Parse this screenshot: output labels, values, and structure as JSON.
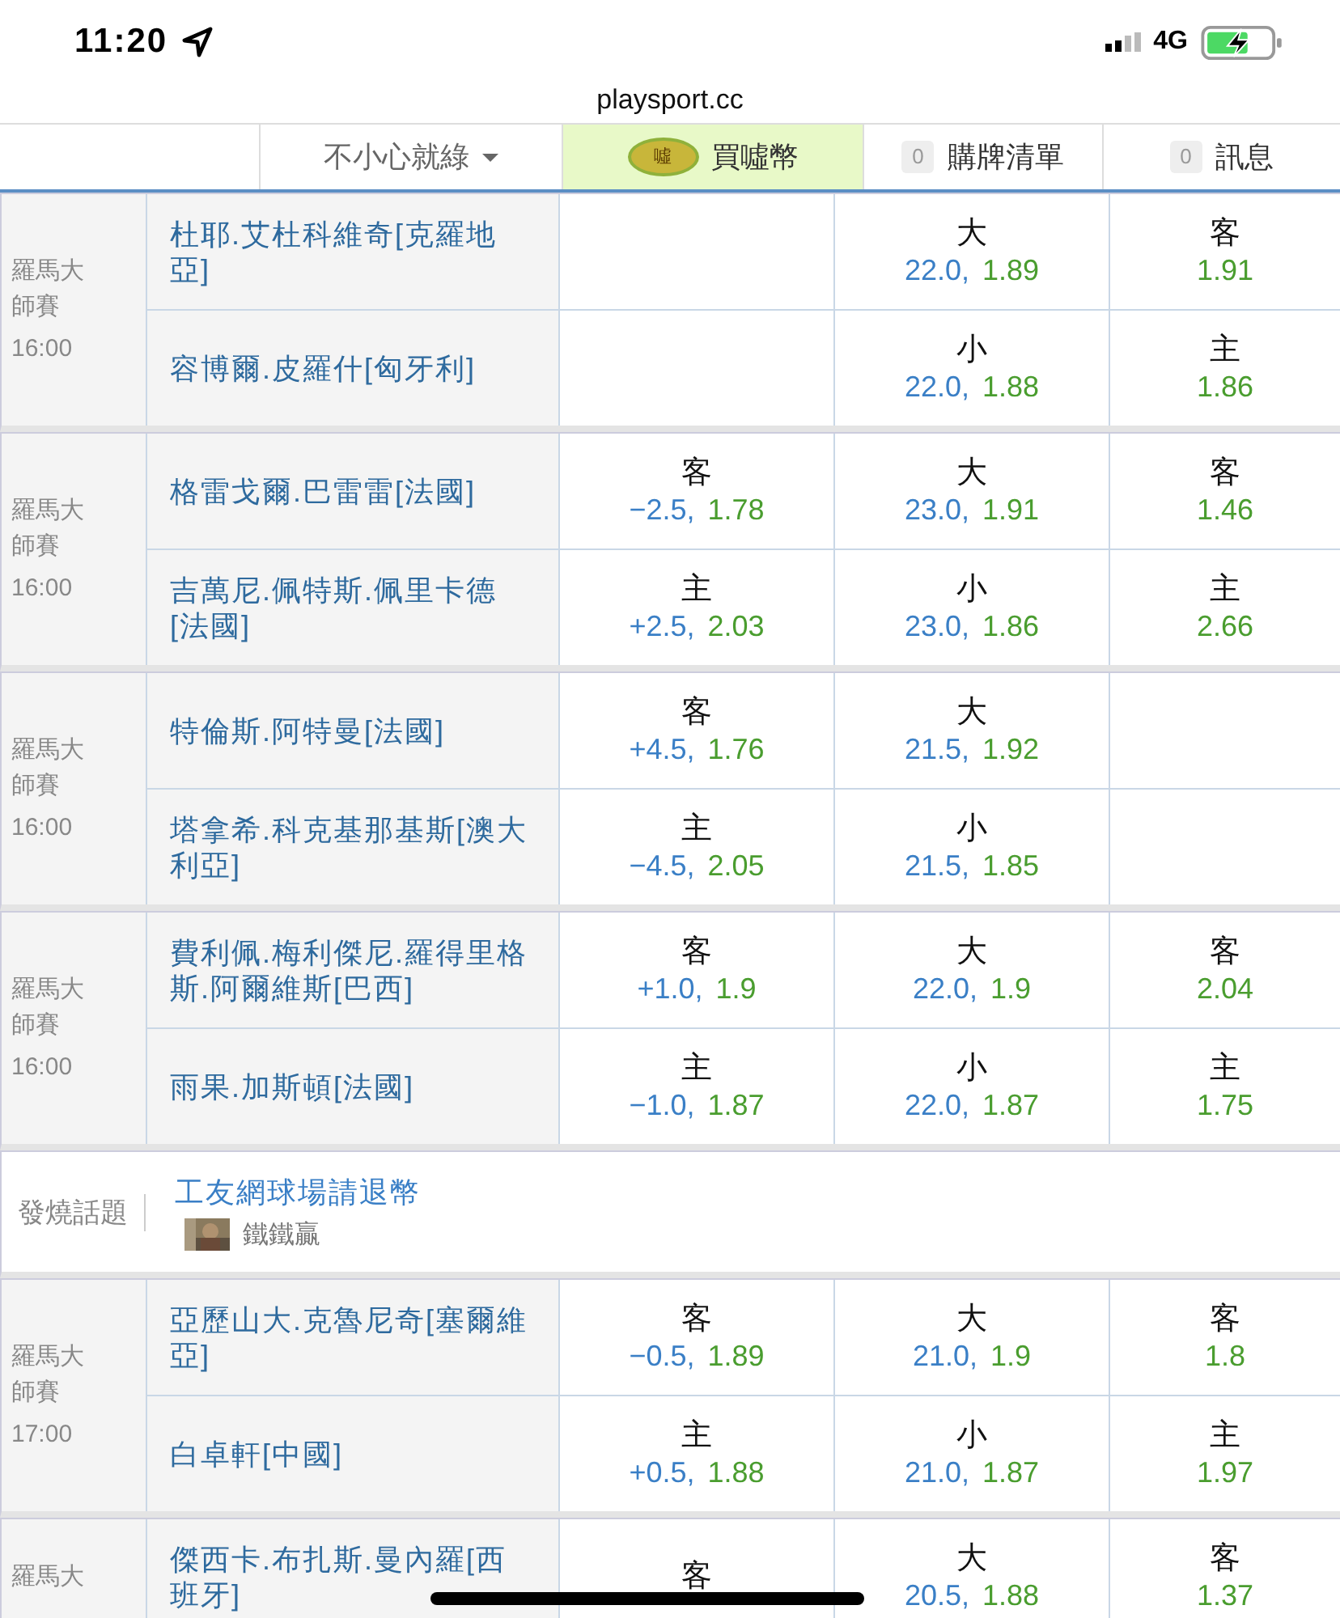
{
  "status_bar": {
    "time": "11:20",
    "network": "4G"
  },
  "url": "playsport.cc",
  "nav": [
    {
      "kind": "blank"
    },
    {
      "kind": "dropdown",
      "label": "不小心就綠"
    },
    {
      "kind": "buy",
      "label": "買噓幣",
      "selected": true,
      "badge": "噓"
    },
    {
      "kind": "counter",
      "label": "購牌清單",
      "count": "0",
      "selected": false
    },
    {
      "kind": "counter",
      "label": "訊息",
      "count": "0",
      "selected": false
    }
  ],
  "groups": [
    {
      "kind": "match",
      "league": "羅馬大師賽",
      "time": "16:00",
      "rows": [
        {
          "player": "杜耶.艾杜科維奇[克羅地亞]",
          "total": {
            "side": "大",
            "line": "22.0,",
            "odds": "1.89"
          },
          "moneyline": {
            "side": "客",
            "odds": "1.91"
          }
        },
        {
          "player": "容博爾.皮羅什[匈牙利]",
          "total": {
            "side": "小",
            "line": "22.0,",
            "odds": "1.88"
          },
          "moneyline": {
            "side": "主",
            "odds": "1.86"
          }
        }
      ]
    },
    {
      "kind": "match",
      "league": "羅馬大師賽",
      "time": "16:00",
      "rows": [
        {
          "player": "格雷戈爾.巴雷雷[法國]",
          "spread": {
            "side": "客",
            "line": "−2.5,",
            "odds": "1.78"
          },
          "total": {
            "side": "大",
            "line": "23.0,",
            "odds": "1.91"
          },
          "moneyline": {
            "side": "客",
            "odds": "1.46"
          }
        },
        {
          "player": "吉萬尼.佩特斯.佩里卡德[法國]",
          "spread": {
            "side": "主",
            "line": "+2.5,",
            "odds": "2.03"
          },
          "total": {
            "side": "小",
            "line": "23.0,",
            "odds": "1.86"
          },
          "moneyline": {
            "side": "主",
            "odds": "2.66"
          }
        }
      ]
    },
    {
      "kind": "match",
      "league": "羅馬大師賽",
      "time": "16:00",
      "rows": [
        {
          "player": "特倫斯.阿特曼[法國]",
          "spread": {
            "side": "客",
            "line": "+4.5,",
            "odds": "1.76"
          },
          "total": {
            "side": "大",
            "line": "21.5,",
            "odds": "1.92"
          }
        },
        {
          "player": "塔拿希.科克基那基斯[澳大利亞]",
          "spread": {
            "side": "主",
            "line": "−4.5,",
            "odds": "2.05"
          },
          "total": {
            "side": "小",
            "line": "21.5,",
            "odds": "1.85"
          }
        }
      ]
    },
    {
      "kind": "match",
      "league": "羅馬大師賽",
      "time": "16:00",
      "rows": [
        {
          "player": "費利佩.梅利傑尼.羅得里格斯.阿爾維斯[巴西]",
          "spread": {
            "side": "客",
            "line": "+1.0,",
            "odds": "1.9"
          },
          "total": {
            "side": "大",
            "line": "22.0,",
            "odds": "1.9"
          },
          "moneyline": {
            "side": "客",
            "odds": "2.04"
          }
        },
        {
          "player": "雨果.加斯頓[法國]",
          "spread": {
            "side": "主",
            "line": "−1.0,",
            "odds": "1.87"
          },
          "total": {
            "side": "小",
            "line": "22.0,",
            "odds": "1.87"
          },
          "moneyline": {
            "side": "主",
            "odds": "1.75"
          }
        }
      ]
    },
    {
      "kind": "topic",
      "label": "發燒話題",
      "title": "工友網球場請退幣",
      "author": "鐵鐵贏"
    },
    {
      "kind": "match",
      "league": "羅馬大師賽",
      "time": "17:00",
      "rows": [
        {
          "player": "亞歷山大.克魯尼奇[塞爾維亞]",
          "spread": {
            "side": "客",
            "line": "−0.5,",
            "odds": "1.89"
          },
          "total": {
            "side": "大",
            "line": "21.0,",
            "odds": "1.9"
          },
          "moneyline": {
            "side": "客",
            "odds": "1.8"
          }
        },
        {
          "player": "白卓軒[中國]",
          "spread": {
            "side": "主",
            "line": "+0.5,",
            "odds": "1.88"
          },
          "total": {
            "side": "小",
            "line": "21.0,",
            "odds": "1.87"
          },
          "moneyline": {
            "side": "主",
            "odds": "1.97"
          }
        }
      ]
    },
    {
      "kind": "match",
      "league": "羅馬大",
      "rows": [
        {
          "player": "傑西卡.布扎斯.曼內羅[西班牙]",
          "spread": {
            "side": "客"
          },
          "total": {
            "side": "大",
            "line": "20.5,",
            "odds": "1.88"
          },
          "moneyline": {
            "side": "客",
            "odds": "1.37"
          }
        }
      ]
    }
  ]
}
